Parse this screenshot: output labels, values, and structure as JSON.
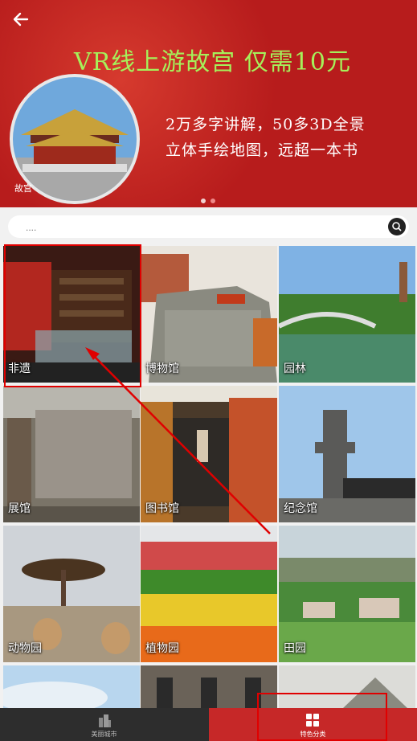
{
  "banner": {
    "headline": "VR线上游故宫  仅需10元",
    "line1": "2万多字讲解，50多3D全景",
    "line2": "立体手绘地图，远超一本书",
    "caption": "故宫"
  },
  "search": {
    "placeholder": "...."
  },
  "categories": [
    {
      "label": "非遗"
    },
    {
      "label": "博物馆"
    },
    {
      "label": "园林"
    },
    {
      "label": "展馆"
    },
    {
      "label": "图书馆"
    },
    {
      "label": "纪念馆"
    },
    {
      "label": "动物园"
    },
    {
      "label": "植物园"
    },
    {
      "label": "田园"
    }
  ],
  "tabs": [
    {
      "label": "美丽城市"
    },
    {
      "label": "特色分类"
    }
  ],
  "colors": {
    "accent": "#c62828",
    "headline": "#a6f05a",
    "highlight": "#e00000"
  }
}
